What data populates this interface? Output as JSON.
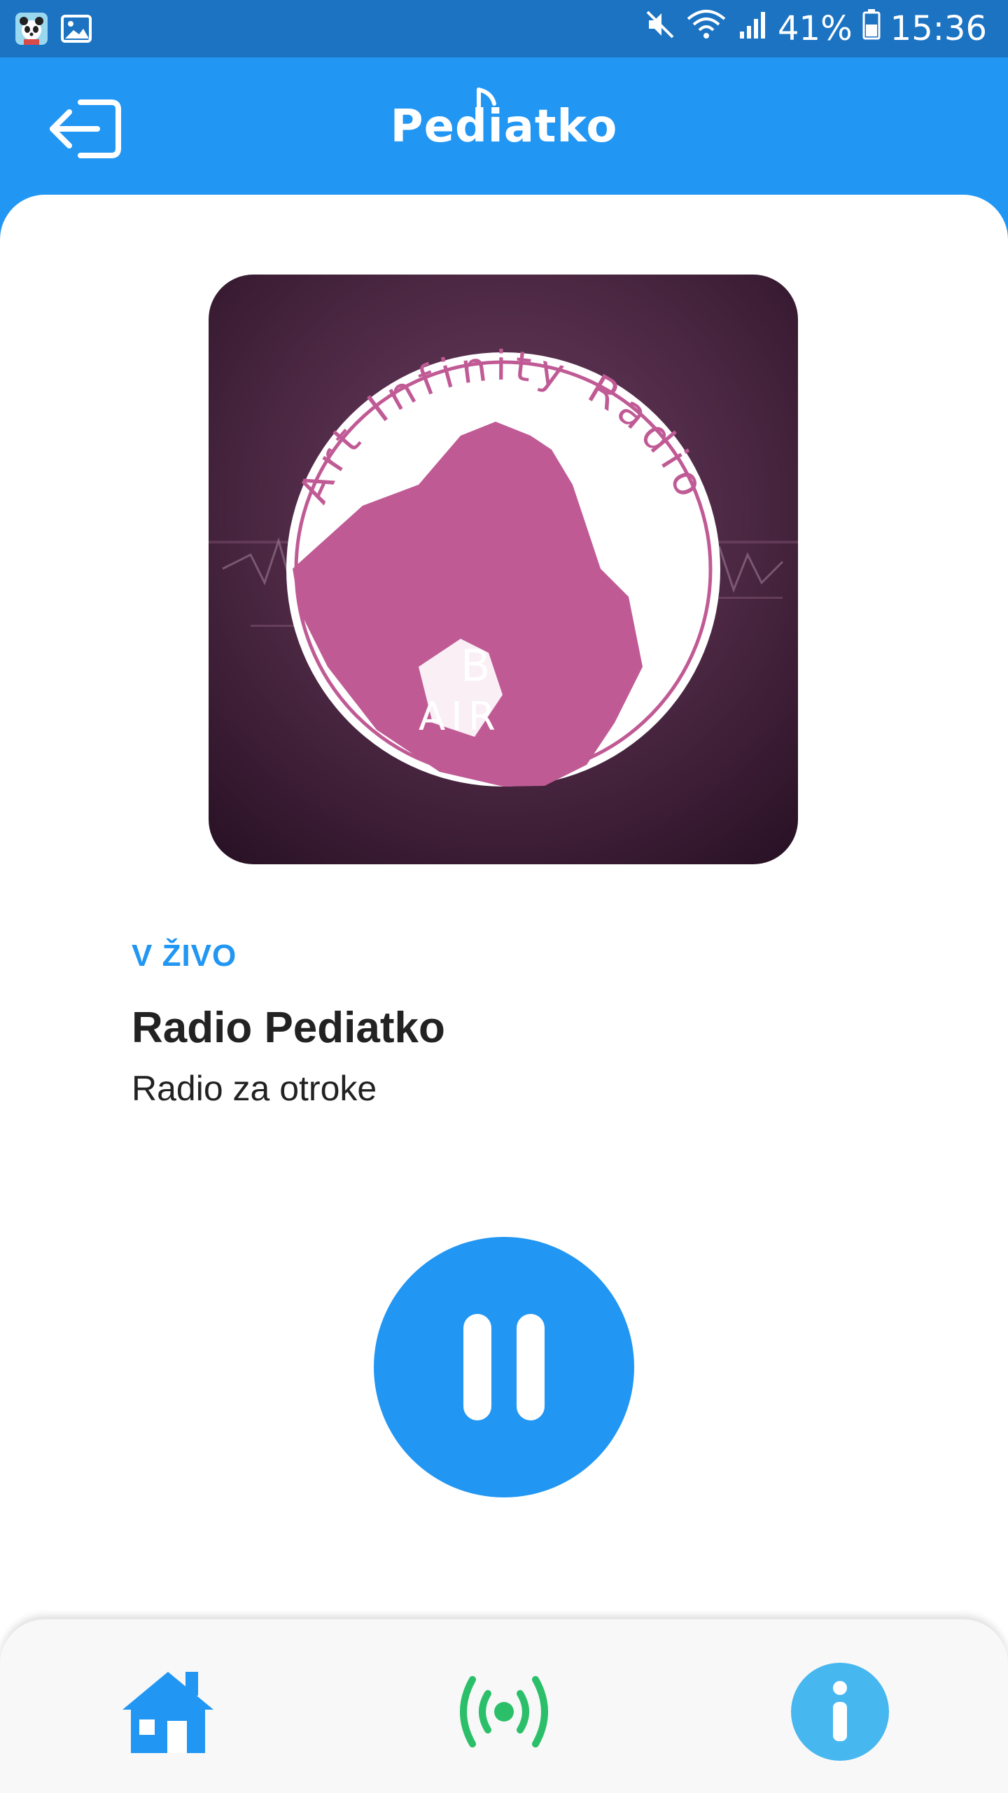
{
  "status_bar": {
    "battery": "41%",
    "time": "15:36",
    "icons": [
      "panda-app-icon",
      "gallery-icon",
      "mute-icon",
      "wifi-icon",
      "signal-icon",
      "battery-icon"
    ]
  },
  "app_bar": {
    "title": "Pediatko",
    "back_icon": "logout-icon"
  },
  "cover": {
    "ring_text": "Art Infinity Radio",
    "badge_text_1": "B",
    "badge_text_2": "AIR"
  },
  "player": {
    "live_label": "V ŽIVO",
    "station_name": "Radio Pediatko",
    "station_description": "Radio za otroke",
    "state_icon": "pause-icon"
  },
  "bottom_nav": {
    "items": [
      "home-icon",
      "broadcast-icon",
      "info-icon"
    ]
  },
  "colors": {
    "primary": "#2196f3",
    "status_bar": "#1b73c2",
    "live": "#2bbf6a",
    "info": "#46b7ef",
    "cover_pink": "#c05a95"
  }
}
